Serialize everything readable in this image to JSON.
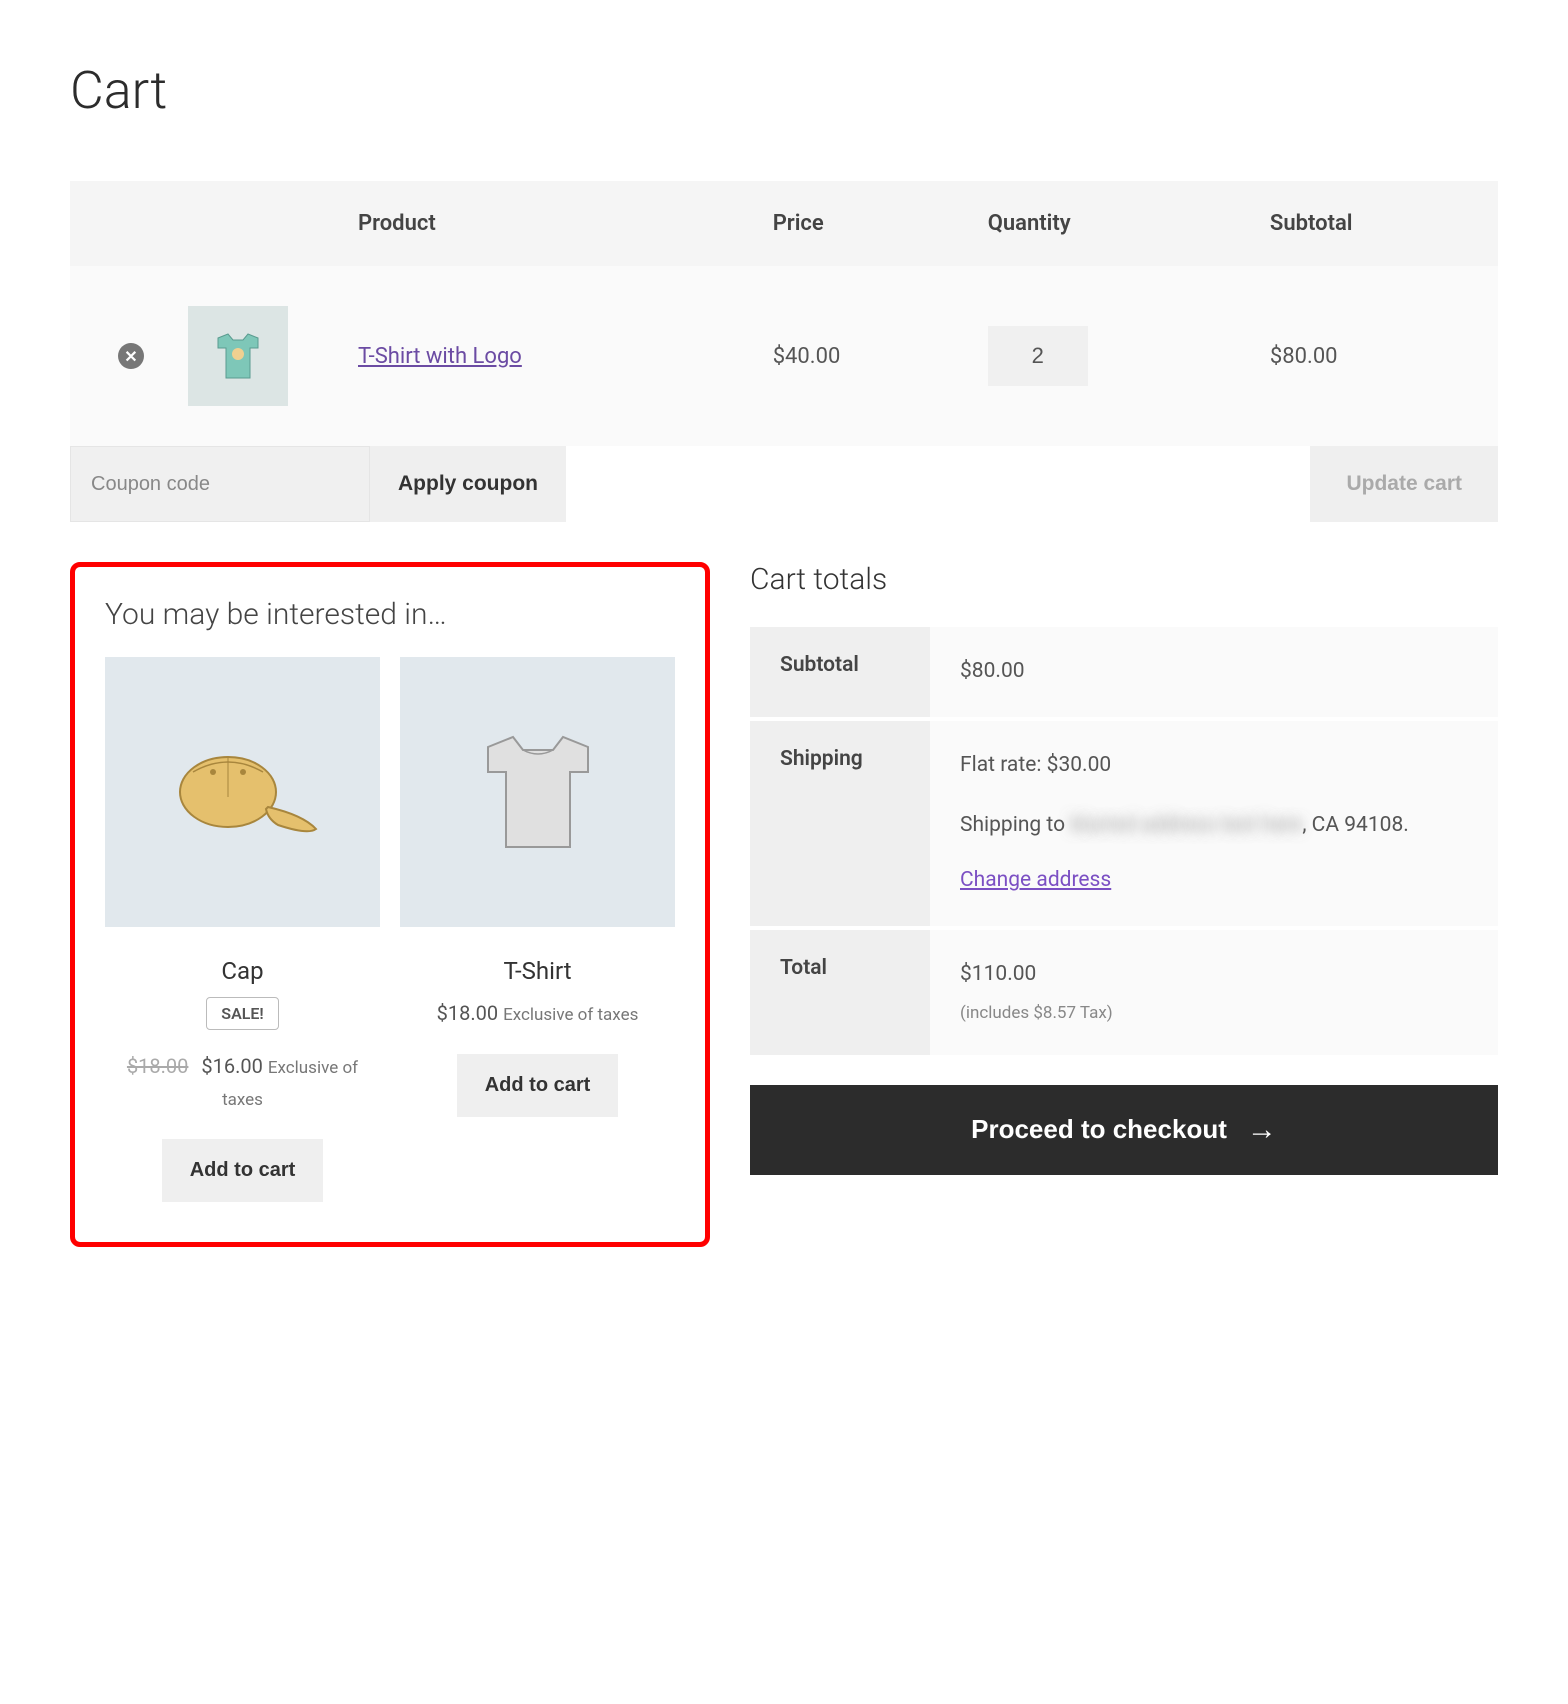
{
  "page": {
    "title": "Cart"
  },
  "cart_table": {
    "headers": {
      "product": "Product",
      "price": "Price",
      "quantity": "Quantity",
      "subtotal": "Subtotal"
    },
    "items": [
      {
        "name": "T-Shirt with Logo",
        "price": "$40.00",
        "quantity": "2",
        "subtotal": "$80.00",
        "image_color": "#7ec7b8"
      }
    ],
    "coupon_placeholder": "Coupon code",
    "apply_coupon_label": "Apply coupon",
    "update_cart_label": "Update cart"
  },
  "interested": {
    "title": "You may be interested in…",
    "products": [
      {
        "name": "Cap",
        "sale_badge": "SALE!",
        "old_price": "$18.00",
        "price": "$16.00",
        "tax_note": "Exclusive of taxes",
        "add_label": "Add to cart",
        "image_color": "#e5c06d"
      },
      {
        "name": "T-Shirt",
        "sale_badge": "",
        "old_price": "",
        "price": "$18.00",
        "tax_note": "Exclusive of taxes",
        "add_label": "Add to cart",
        "image_color": "#d3d3d3"
      }
    ]
  },
  "cart_totals": {
    "title": "Cart totals",
    "subtotal_label": "Subtotal",
    "subtotal_value": "$80.00",
    "shipping_label": "Shipping",
    "shipping_rate": "Flat rate: $30.00",
    "shipping_to_prefix": "Shipping to",
    "shipping_address_blurred": "blurred address text here",
    "shipping_address_visible": ", CA 94108.",
    "change_address_label": "Change address",
    "total_label": "Total",
    "total_value": "$110.00",
    "tax_includes": "(includes $8.57 Tax)"
  },
  "checkout": {
    "button_label": "Proceed to checkout"
  }
}
